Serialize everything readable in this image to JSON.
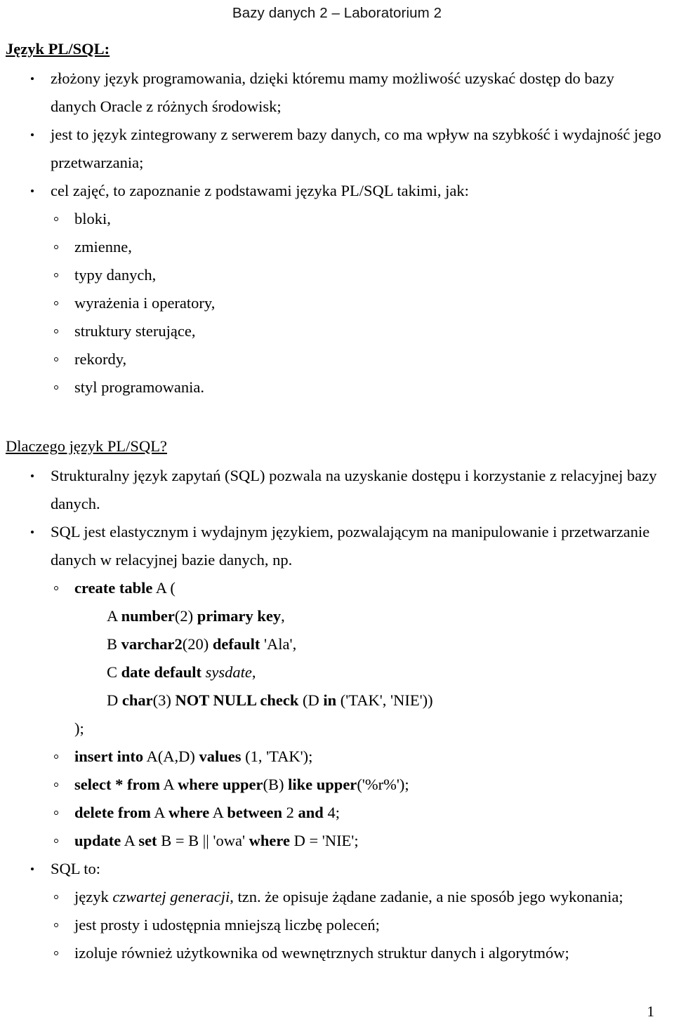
{
  "header": {
    "running_title": "Bazy danych 2 – Laboratorium 2"
  },
  "sections": [
    {
      "heading": "Język PL/SQL:",
      "heading_style": "bold-underline",
      "bullets": [
        "złożony język programowania, dzięki któremu mamy możliwość uzyskać dostęp do bazy danych Oracle z różnych środowisk;",
        "jest to język zintegrowany z serwerem bazy danych, co ma wpływ na szybkość i wydajność jego przetwarzania;",
        "cel zajęć, to zapoznanie z podstawami języka PL/SQL takimi, jak:"
      ],
      "subbullets": [
        "bloki,",
        "zmienne,",
        "typy danych,",
        "wyrażenia i operatory,",
        "struktury sterujące,",
        "rekordy,",
        "styl programowania."
      ]
    },
    {
      "heading": "Dlaczego język PL/SQL?",
      "heading_style": "plain-underline",
      "bullets": [
        "Strukturalny język zapytań (SQL) pozwala na uzyskanie dostępu i korzystanie z relacyjnej bazy danych.",
        "SQL jest elastycznym i wydajnym językiem, pozwalającym na manipulowanie i przetwarzanie danych w relacyjnej bazie danych, np."
      ]
    }
  ],
  "sql_examples": {
    "create_table": {
      "line1_kw": "create table",
      "line1_rest": " A (",
      "col_a": {
        "name": "A ",
        "kw1": "number",
        "mid1": "(2) ",
        "kw2": "primary key",
        "tail": ","
      },
      "col_b": {
        "name": "B ",
        "kw1": "varchar2",
        "mid1": "(20) ",
        "kw2": "default",
        "tail": " 'Ala',"
      },
      "col_c": {
        "name": "C ",
        "kw1": "date default",
        "mid1": " ",
        "italic": "sysdate",
        "tail": ","
      },
      "col_d": {
        "name": "D ",
        "kw1": "char",
        "mid1": "(3) ",
        "kw2": "NOT NULL check",
        "mid2": " (D ",
        "kw3": "in",
        "tail": " ('TAK', 'NIE'))"
      },
      "close": ");"
    },
    "insert": {
      "kw1": "insert into",
      "mid1": " A(A,D) ",
      "kw2": "values",
      "tail": " (1, 'TAK');"
    },
    "select": {
      "kw1": "select * from",
      "mid1": " A ",
      "kw2": "where upper",
      "mid2": "(B) ",
      "kw3": "like upper",
      "tail": "('%r%');"
    },
    "delete": {
      "kw1": "delete from",
      "mid1": " A ",
      "kw2": "where",
      "mid2": " A ",
      "kw3": "between",
      "mid3": " 2 ",
      "kw4": "and",
      "tail": " 4;"
    },
    "update": {
      "kw1": "update",
      "mid1": " A ",
      "kw2": "set",
      "mid2": " B = B || 'owa' ",
      "kw3": "where",
      "tail": " D = 'NIE';"
    }
  },
  "sql_to": {
    "label": "SQL to:",
    "items": [
      {
        "pre": "język ",
        "italic": "czwartej generacji",
        "post": ", tzn. że opisuje żądane zadanie, a nie sposób jego wykonania;"
      },
      {
        "pre": "jest prosty i udostępnia mniejszą liczbę poleceń;",
        "italic": "",
        "post": ""
      },
      {
        "pre": "izoluje również użytkownika od wewnętrznych struktur danych i algorytmów;",
        "italic": "",
        "post": ""
      }
    ]
  },
  "footer": {
    "page_number": "1"
  }
}
